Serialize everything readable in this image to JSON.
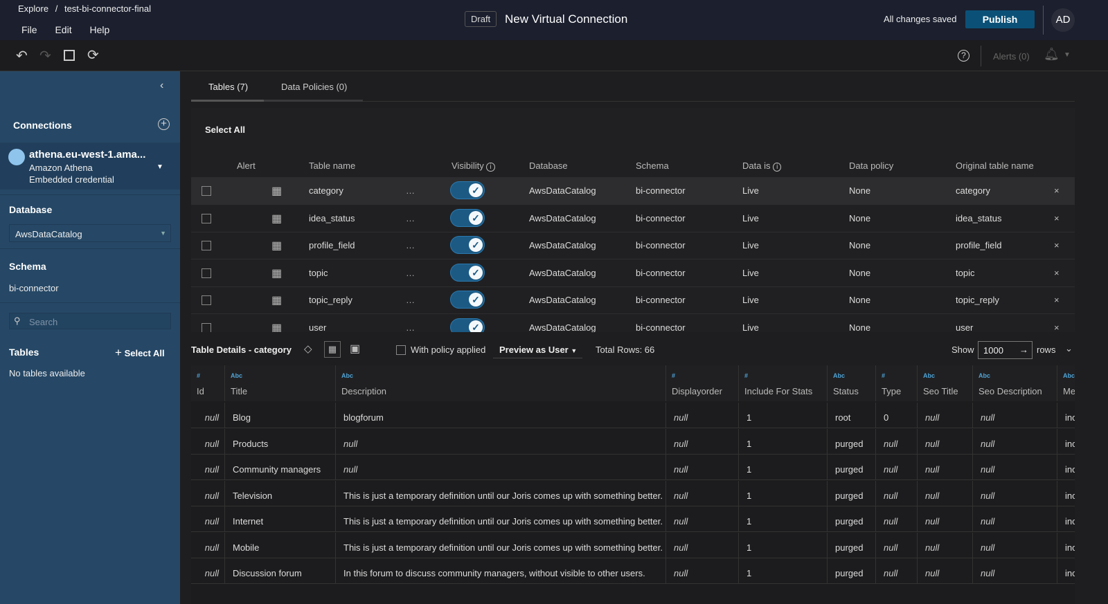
{
  "header": {
    "breadcrumb_root": "Explore",
    "breadcrumb_sep": "/",
    "breadcrumb_item": "test-bi-connector-final",
    "menu": [
      "File",
      "Edit",
      "Help"
    ],
    "draft_badge": "Draft",
    "title": "New Virtual Connection",
    "save_status": "All changes saved",
    "publish_label": "Publish",
    "avatar": "AD",
    "accent": "#0b5177"
  },
  "toolbar": {
    "icons": [
      "undo-icon",
      "redo-icon",
      "save-icon",
      "refresh-icon"
    ],
    "alerts": "Alerts (0)"
  },
  "sidebar": {
    "connections_label": "Connections",
    "connection": {
      "name": "athena.eu-west-1.ama...",
      "type": "Amazon Athena",
      "auth": "Embedded credential"
    },
    "database_label": "Database",
    "database_value": "AwsDataCatalog",
    "schema_label": "Schema",
    "schema_value": "bi-connector",
    "search_placeholder": "Search",
    "tables_label": "Tables",
    "select_all": "Select All",
    "no_tables": "No tables available"
  },
  "tabs": [
    {
      "label": "Tables (7)",
      "active": true
    },
    {
      "label": "Data Policies (0)",
      "active": false
    }
  ],
  "tables": {
    "select_all": "Select All",
    "columns": [
      "Alert",
      "Table name",
      "Visibility",
      "Database",
      "Schema",
      "Data is",
      "Data policy",
      "Original table name"
    ],
    "rows": [
      {
        "name": "category",
        "visible": true,
        "database": "AwsDataCatalog",
        "schema": "bi-connector",
        "data_is": "Live",
        "policy": "None",
        "original": "category"
      },
      {
        "name": "idea_status",
        "visible": true,
        "database": "AwsDataCatalog",
        "schema": "bi-connector",
        "data_is": "Live",
        "policy": "None",
        "original": "idea_status"
      },
      {
        "name": "profile_field",
        "visible": true,
        "database": "AwsDataCatalog",
        "schema": "bi-connector",
        "data_is": "Live",
        "policy": "None",
        "original": "profile_field"
      },
      {
        "name": "topic",
        "visible": true,
        "database": "AwsDataCatalog",
        "schema": "bi-connector",
        "data_is": "Live",
        "policy": "None",
        "original": "topic"
      },
      {
        "name": "topic_reply",
        "visible": true,
        "database": "AwsDataCatalog",
        "schema": "bi-connector",
        "data_is": "Live",
        "policy": "None",
        "original": "topic_reply"
      },
      {
        "name": "user",
        "visible": true,
        "database": "AwsDataCatalog",
        "schema": "bi-connector",
        "data_is": "Live",
        "policy": "None",
        "original": "user"
      }
    ]
  },
  "details": {
    "title": "Table Details - category",
    "with_policy": "With policy applied",
    "preview_as": "Preview as User",
    "total_rows": "Total Rows: 66",
    "show": "Show",
    "rows_value": "1000",
    "rows": "rows",
    "columns": [
      {
        "type": "#",
        "name": "Id"
      },
      {
        "type": "Abc",
        "name": "Title"
      },
      {
        "type": "Abc",
        "name": "Description"
      },
      {
        "type": "#",
        "name": "Displayorder"
      },
      {
        "type": "#",
        "name": "Include For Stats"
      },
      {
        "type": "Abc",
        "name": "Status"
      },
      {
        "type": "#",
        "name": "Type"
      },
      {
        "type": "Abc",
        "name": "Seo Title"
      },
      {
        "type": "Abc",
        "name": "Seo Description"
      },
      {
        "type": "Abc",
        "name": "Me"
      }
    ],
    "data": [
      [
        "null",
        "Blog",
        "blogforum",
        "null",
        "1",
        "root",
        "0",
        "null",
        "null",
        "inc"
      ],
      [
        "null",
        "Products",
        "null",
        "null",
        "1",
        "purged",
        "null",
        "null",
        "null",
        "inc"
      ],
      [
        "null",
        "Community managers",
        "null",
        "null",
        "1",
        "purged",
        "null",
        "null",
        "null",
        "inc"
      ],
      [
        "null",
        "Television",
        "This is just a temporary definition until our Joris comes up with something better.",
        "null",
        "1",
        "purged",
        "null",
        "null",
        "null",
        "inc"
      ],
      [
        "null",
        "Internet",
        "This is just a temporary definition until our Joris comes up with something better.",
        "null",
        "1",
        "purged",
        "null",
        "null",
        "null",
        "inc"
      ],
      [
        "null",
        "Mobile",
        "This is just a temporary definition until our Joris comes up with something better.",
        "null",
        "1",
        "purged",
        "null",
        "null",
        "null",
        "inc"
      ],
      [
        "null",
        "Discussion forum",
        "In this forum to discuss community managers, without visible to other users.",
        "null",
        "1",
        "purged",
        "null",
        "null",
        "null",
        "inc"
      ]
    ]
  }
}
